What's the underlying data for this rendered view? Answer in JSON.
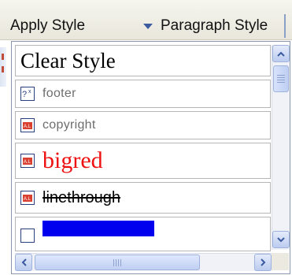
{
  "toolbar": {
    "apply_style_label": "Apply Style",
    "paragraph_style_label": "Paragraph Style"
  },
  "dropdown": {
    "items": [
      {
        "label": "Clear Style",
        "icon": "none"
      },
      {
        "label": "footer",
        "icon": "paragraph-style-icon"
      },
      {
        "label": "copyright",
        "icon": "character-style-icon"
      },
      {
        "label": "bigred",
        "icon": "character-style-icon"
      },
      {
        "label": "linethrough",
        "icon": "character-style-icon"
      },
      {
        "label": "",
        "icon": "character-style-icon"
      }
    ]
  },
  "colors": {
    "bigred": "#ee1111",
    "highlight": "#0000ee",
    "scrollbar": "#bfcff3"
  },
  "icons": {
    "combo_arrow": "triangle-down-icon",
    "scroll_up": "chevron-up-icon",
    "scroll_down": "chevron-down-icon",
    "scroll_left": "chevron-left-icon",
    "scroll_right": "chevron-right-icon"
  }
}
